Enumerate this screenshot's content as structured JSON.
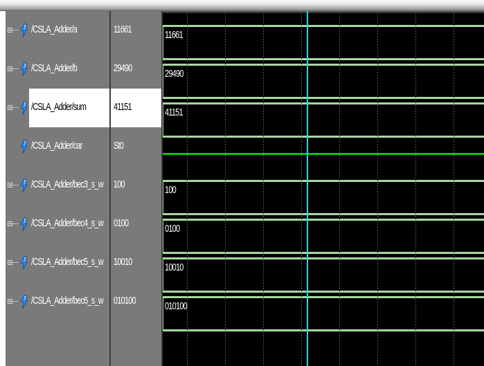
{
  "signals": [
    {
      "name": "/CSLA_Adder/a",
      "value": "11661",
      "wave_value": "11661",
      "kind": "bus",
      "expandable": true,
      "selected": false
    },
    {
      "name": "/CSLA_Adder/b",
      "value": "29490",
      "wave_value": "29490",
      "kind": "bus",
      "expandable": true,
      "selected": false
    },
    {
      "name": "/CSLA_Adder/sum",
      "value": "41151",
      "wave_value": "41151",
      "kind": "bus",
      "expandable": true,
      "selected": true
    },
    {
      "name": "/CSLA_Adder/car",
      "value": "St0",
      "wave_value": "",
      "kind": "scalar",
      "expandable": false,
      "selected": false
    },
    {
      "name": "/CSLA_Adder/bec3_s_w",
      "value": "100",
      "wave_value": "100",
      "kind": "bus",
      "expandable": true,
      "selected": false
    },
    {
      "name": "/CSLA_Adder/bec4_s_w",
      "value": "0100",
      "wave_value": "0100",
      "kind": "bus",
      "expandable": true,
      "selected": false
    },
    {
      "name": "/CSLA_Adder/bec5_s_w",
      "value": "10010",
      "wave_value": "10010",
      "kind": "bus",
      "expandable": true,
      "selected": false
    },
    {
      "name": "/CSLA_Adder/bec6_s_w",
      "value": "010100",
      "wave_value": "010100",
      "kind": "bus",
      "expandable": true,
      "selected": false
    }
  ],
  "icons": {
    "expand": "plus-box-icon",
    "signal": "signal-probe-icon"
  },
  "colors": {
    "pane_gray": "#7a7a7a",
    "wave_background": "#000000",
    "bus_line": "#a8d8a0",
    "scalar_line": "#00cc00",
    "cursor": "#00e0ff",
    "selected_row": "#ffffff"
  }
}
